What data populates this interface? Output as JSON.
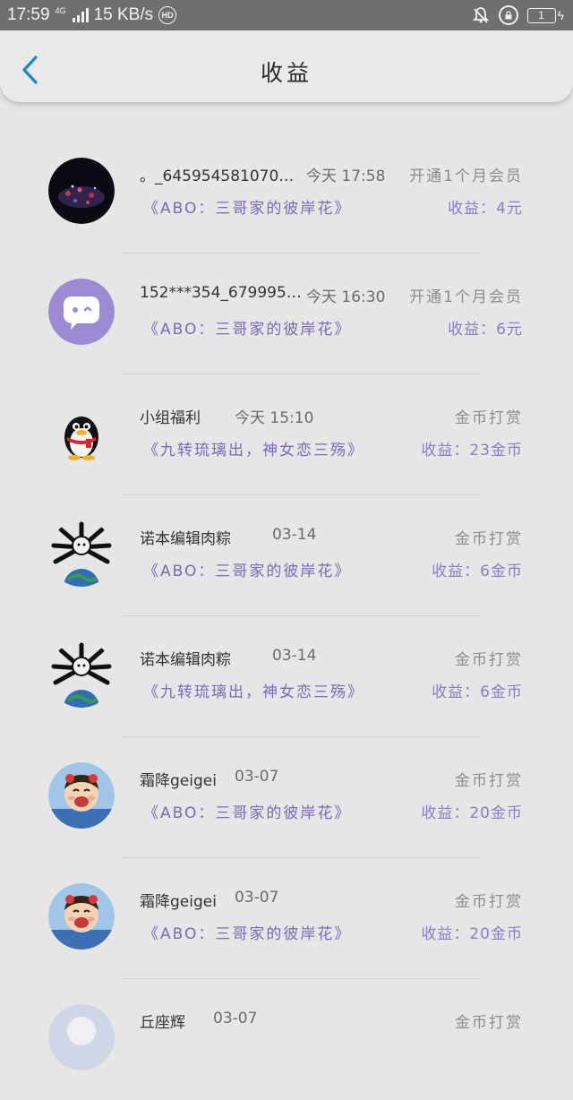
{
  "status_bar": {
    "time": "17:59",
    "network": "4G",
    "speed": "15 KB/s",
    "hd": "HD",
    "battery": "1"
  },
  "header": {
    "title": "收益"
  },
  "items": [
    {
      "name": "。_645954581070…",
      "time": "今天 17:58",
      "type": "开通1个月会员",
      "book": "《ABO：三哥家的彼岸花》",
      "earning": "收益：4元"
    },
    {
      "name": "152***354_679995…",
      "time": "今天 16:30",
      "type": "开通1个月会员",
      "book": "《ABO：三哥家的彼岸花》",
      "earning": "收益：6元"
    },
    {
      "name": "小组福利",
      "time": "今天 15:10",
      "type": "金币打赏",
      "book": "《九转琉璃出，神女恋三殇》",
      "earning": "收益：23金币"
    },
    {
      "name": "诺本编辑肉粽",
      "time": "03-14",
      "type": "金币打赏",
      "book": "《ABO：三哥家的彼岸花》",
      "earning": "收益：6金币"
    },
    {
      "name": "诺本编辑肉粽",
      "time": "03-14",
      "type": "金币打赏",
      "book": "《九转琉璃出，神女恋三殇》",
      "earning": "收益：6金币"
    },
    {
      "name": "霜降geigei",
      "time": "03-07",
      "type": "金币打赏",
      "book": "《ABO：三哥家的彼岸花》",
      "earning": "收益：20金币"
    },
    {
      "name": "霜降geigei",
      "time": "03-07",
      "type": "金币打赏",
      "book": "《ABO：三哥家的彼岸花》",
      "earning": "收益：20金币"
    },
    {
      "name": "丘座辉",
      "time": "03-07",
      "type": "金币打赏",
      "book": "",
      "earning": ""
    }
  ]
}
